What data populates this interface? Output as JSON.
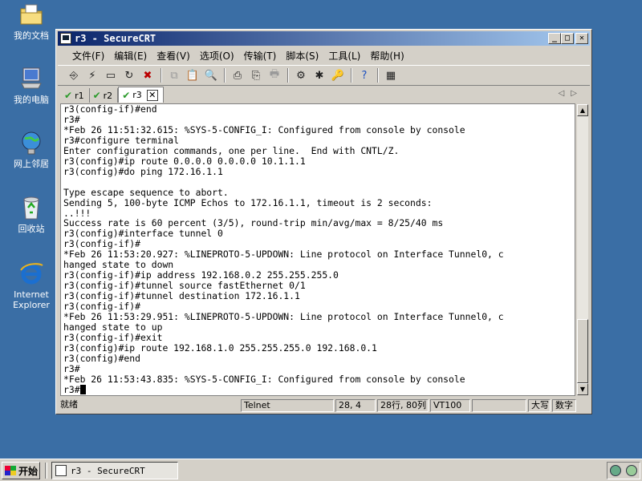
{
  "desktop": {
    "icons": [
      {
        "label": "我的文档",
        "icon": "my-documents-icon"
      },
      {
        "label": "我的电脑",
        "icon": "my-computer-icon"
      },
      {
        "label": "网上邻居",
        "icon": "network-places-icon"
      },
      {
        "label": "回收站",
        "icon": "recycle-bin-icon"
      },
      {
        "label": "Internet Explorer",
        "icon": "internet-explorer-icon"
      }
    ]
  },
  "window": {
    "title": "r3 - SecureCRT",
    "menu": [
      "文件(F)",
      "编辑(E)",
      "查看(V)",
      "选项(O)",
      "传输(T)",
      "脚本(S)",
      "工具(L)",
      "帮助(H)"
    ],
    "tabs": [
      {
        "label": "r1",
        "active": false
      },
      {
        "label": "r2",
        "active": false
      },
      {
        "label": "r3",
        "active": true
      }
    ],
    "terminal_lines": [
      "r3(config-if)#end",
      "r3#",
      "*Feb 26 11:51:32.615: %SYS-5-CONFIG_I: Configured from console by console",
      "r3#configure terminal",
      "Enter configuration commands, one per line.  End with CNTL/Z.",
      "r3(config)#ip route 0.0.0.0 0.0.0.0 10.1.1.1",
      "r3(config)#do ping 172.16.1.1",
      "",
      "Type escape sequence to abort.",
      "Sending 5, 100-byte ICMP Echos to 172.16.1.1, timeout is 2 seconds:",
      "..!!!",
      "Success rate is 60 percent (3/5), round-trip min/avg/max = 8/25/40 ms",
      "r3(config)#interface tunnel 0",
      "r3(config-if)#",
      "*Feb 26 11:53:20.927: %LINEPROTO-5-UPDOWN: Line protocol on Interface Tunnel0, c",
      "hanged state to down",
      "r3(config-if)#ip address 192.168.0.2 255.255.255.0",
      "r3(config-if)#tunnel source fastEthernet 0/1",
      "r3(config-if)#tunnel destination 172.16.1.1",
      "r3(config-if)#",
      "*Feb 26 11:53:29.951: %LINEPROTO-5-UPDOWN: Line protocol on Interface Tunnel0, c",
      "hanged state to up",
      "r3(config-if)#exit",
      "r3(config)#ip route 192.168.1.0 255.255.255.0 192.168.0.1",
      "r3(config)#end",
      "r3#",
      "*Feb 26 11:53:43.835: %SYS-5-CONFIG_I: Configured from console by console",
      "r3#"
    ],
    "status": {
      "ready": "就绪",
      "protocol": "Telnet",
      "cursor_pos": "28,  4",
      "size": "28行, 80列",
      "emulation": "VT100",
      "caps": "大写",
      "num": "数字"
    }
  },
  "taskbar": {
    "start_label": "开始",
    "task_item": "r3 - SecureCRT"
  }
}
